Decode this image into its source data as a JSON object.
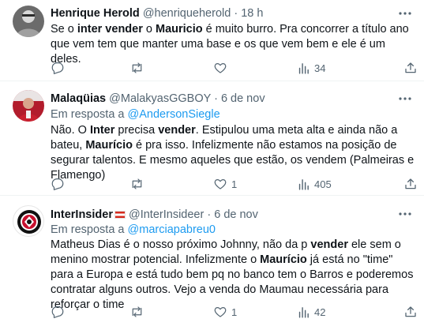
{
  "tweets": [
    {
      "author_name": "Henrique Herold",
      "author_handle": "@henriqueherold",
      "dot": "·",
      "time": "18 h",
      "text": [
        {
          "t": "Se o ",
          "b": false
        },
        {
          "t": "inter vender",
          "b": true
        },
        {
          "t": " o ",
          "b": false
        },
        {
          "t": "Mauricio",
          "b": true
        },
        {
          "t": " é muito burro. Pra concorrer a título ano que vem tem que manter uma base e os que vem bem e ele é um deles.",
          "b": false
        }
      ],
      "views": "34"
    },
    {
      "author_name": "Malaqüias",
      "author_handle": "@MalakyasGGBOY",
      "dot": "·",
      "time": "6 de nov",
      "reply_prefix": "Em resposta a",
      "reply_to": "@AndersonSiegle",
      "text": [
        {
          "t": "Não. O ",
          "b": false
        },
        {
          "t": "Inter",
          "b": true
        },
        {
          "t": " precisa ",
          "b": false
        },
        {
          "t": "vender",
          "b": true
        },
        {
          "t": ". Estipulou uma meta alta e ainda não a bateu, ",
          "b": false
        },
        {
          "t": "Maurício",
          "b": true
        },
        {
          "t": " é pra isso. Infelizmente não estamos na posição de segurar talentos. E mesmo aqueles que estão, os vendem (Palmeiras e Flamengo)",
          "b": false
        }
      ],
      "likes": "1",
      "views": "405"
    },
    {
      "author_name": "InterInsider",
      "author_handle": "@InterInsideer",
      "dot": "·",
      "time": "6 de nov",
      "reply_prefix": "Em resposta a",
      "reply_to": "@marciapabreu0",
      "text": [
        {
          "t": "Matheus Dias é o nosso próximo Johnny, não da p ",
          "b": false
        },
        {
          "t": "vender",
          "b": true
        },
        {
          "t": " ele sem o menino mostrar potencial. Infelizmente o ",
          "b": false
        },
        {
          "t": "Maurício",
          "b": true
        },
        {
          "t": " já está no \"time\" para a Europa e está tudo bem pq no banco tem o Barros e poderemos contratar alguns outros. Vejo a venda do Maumau necessária para reforçar o time",
          "b": false
        }
      ],
      "likes": "1",
      "views": "42"
    }
  ]
}
